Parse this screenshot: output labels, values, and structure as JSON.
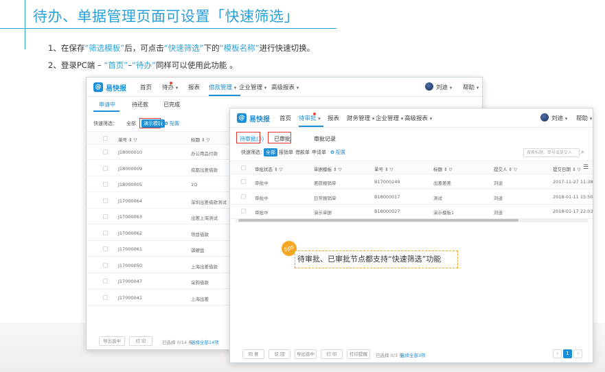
{
  "header": {
    "title": "待办、单据管理页面可设置「快速筛选」",
    "steps": [
      {
        "parts": [
          {
            "t": "1、在保存",
            "hl": false
          },
          {
            "t": "“筛选模板”",
            "hl": true
          },
          {
            "t": "后，可点击",
            "hl": false
          },
          {
            "t": "“快速筛选”",
            "hl": true
          },
          {
            "t": "下的",
            "hl": false
          },
          {
            "t": "“模板名称”",
            "hl": true
          },
          {
            "t": "进行快速切换。",
            "hl": false
          }
        ]
      },
      {
        "parts": [
          {
            "t": "2、登录PC端 – ",
            "hl": false
          },
          {
            "t": "“首页”",
            "hl": true
          },
          {
            "t": "–",
            "hl": false
          },
          {
            "t": "“待办”",
            "hl": true
          },
          {
            "t": "同样可以使用此功能 。",
            "hl": false
          }
        ]
      }
    ]
  },
  "back_window": {
    "logo_text": "易快报",
    "nav": [
      "首页",
      "待办",
      "报表",
      "借款管理",
      "企业管理",
      "高级报表"
    ],
    "active_nav": "借款管理",
    "user": "刘迪",
    "help": "帮助",
    "tabs": [
      "申请中",
      "待还款",
      "已完成"
    ],
    "filter_label": "快速筛选：",
    "filter_all": "全部",
    "filter_template": "演示模板",
    "filter_config": "配置",
    "columns": [
      "单号",
      "标题"
    ],
    "rows": [
      [
        "J18000010",
        "办公用品付款"
      ],
      [
        "J18000009",
        "成都出差借款"
      ],
      [
        "J18000005",
        "1Q"
      ],
      [
        "J17000064",
        "深圳出差借款测试"
      ],
      [
        "J17000063",
        "出差上海测试"
      ],
      [
        "J17000062",
        "项目借款"
      ],
      [
        "J17000061",
        "驿硬盘"
      ],
      [
        "J17000050",
        "上海出差借款"
      ],
      [
        "J17000047",
        "采购借款"
      ],
      [
        "J17000041",
        "上海出差"
      ]
    ],
    "footer": {
      "export": "导出选中",
      "print": "打 印",
      "selected": "已选择 0/14 条",
      "select_all": "选择全部14项"
    }
  },
  "front_window": {
    "logo_text": "易快报",
    "nav": [
      "首页",
      "待审批",
      "报表",
      "财务管理",
      "企业管理",
      "高级报表"
    ],
    "active_nav": "待审批",
    "user": "刘迪",
    "help": "帮助",
    "tabs": [
      "待审批(3)",
      "已审批",
      "审批记录"
    ],
    "filter_label": "快速筛选：",
    "filter_chips": [
      "全部",
      "报销单",
      "借款单",
      "申请单"
    ],
    "filter_config": "配置",
    "search_placeholder": "搜索标题、单号或提交人",
    "columns": [
      "审批状态",
      "单据模板",
      "单号",
      "标题",
      "提交人",
      "提交日期"
    ],
    "rows": [
      [
        "审批中",
        "差旅报销单",
        "B17000249",
        "出差差差",
        "刘迪",
        "2017-11-27 11:38"
      ],
      [
        "审批中",
        "日常报销单",
        "B18000017",
        "测试",
        "刘迪",
        "2018-01-11 15:50"
      ],
      [
        "审批中",
        "演示单据",
        "B18000027",
        "演示模板1",
        "刘迪",
        "2018-01-17 22:03"
      ]
    ],
    "footer": {
      "approve": "同 意",
      "reject": "驳 回",
      "export": "导出选中",
      "print": "打 印",
      "print_reminder": "打印提醒",
      "selected": "已选择 0/3 条",
      "select_all": "选择全部3项"
    },
    "page": "1"
  },
  "tips": {
    "bubble": "tips",
    "text": "待审批、已审批节点都支持“快速筛选”功能"
  },
  "colors": {
    "accent": "#2aa1d7",
    "app_blue": "#1a8fd8",
    "highlight_red": "#e5322d",
    "tips_orange": "#f5a623"
  }
}
